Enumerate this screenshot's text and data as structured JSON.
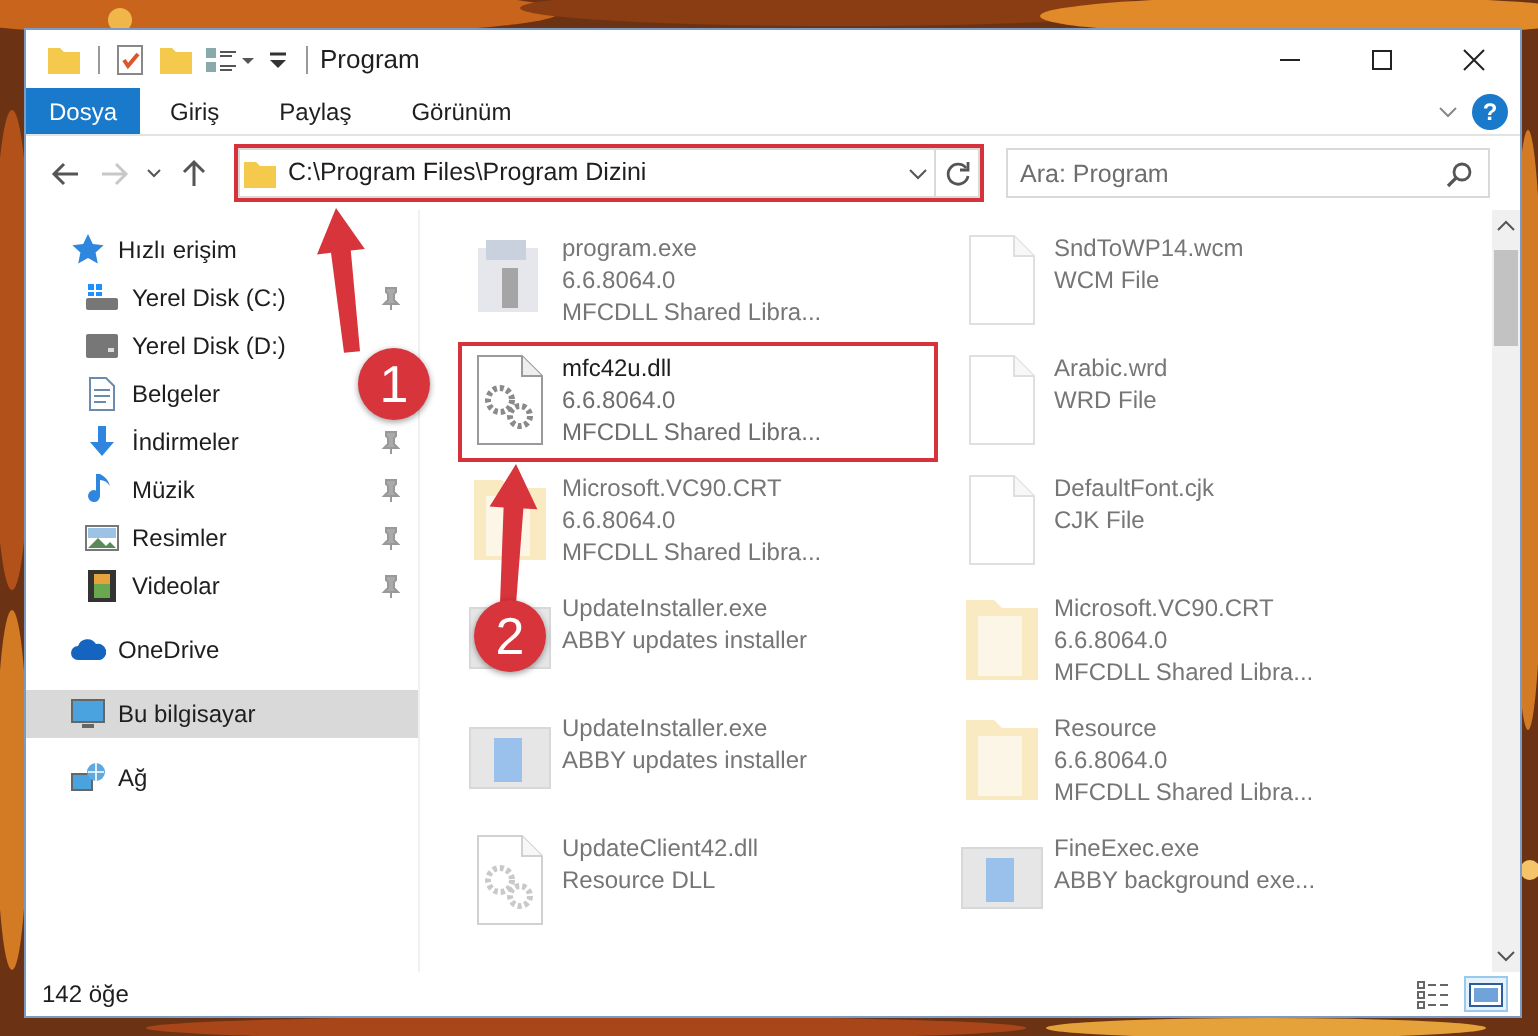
{
  "window": {
    "title": "Program"
  },
  "ribbon_tabs": [
    {
      "label": "Dosya",
      "kind": "file"
    },
    {
      "label": "Giriş",
      "kind": "tab"
    },
    {
      "label": "Paylaş",
      "kind": "tab"
    },
    {
      "label": "Görünüm",
      "kind": "tab"
    }
  ],
  "help": "?",
  "navigation": {
    "back_disabled": false,
    "forward_disabled": true
  },
  "address": {
    "path": "C:\\Program Files\\Program Dizini",
    "annotated": true
  },
  "search": {
    "placeholder": "Ara: Program"
  },
  "sidebar": {
    "items": [
      {
        "label": "Hızlı erişim",
        "kind": "star",
        "selected": false,
        "children": [
          {
            "label": "Yerel Disk (C:)",
            "kind": "system-drive",
            "pinned": true,
            "selected": false
          },
          {
            "label": "Yerel Disk (D:)",
            "kind": "drive",
            "pinned": false,
            "selected": false
          },
          {
            "label": "Belgeler",
            "kind": "documents",
            "pinned": false,
            "selected": false
          },
          {
            "label": "İndirmeler",
            "kind": "downloads",
            "pinned": true,
            "selected": false
          },
          {
            "label": "Müzik",
            "kind": "music",
            "pinned": true,
            "selected": false
          },
          {
            "label": "Resimler",
            "kind": "pictures",
            "pinned": true,
            "selected": false
          },
          {
            "label": "Videolar",
            "kind": "videos",
            "pinned": true,
            "selected": false
          }
        ]
      },
      {
        "label": "OneDrive",
        "kind": "cloud",
        "selected": false
      },
      {
        "label": "Bu bilgisayar",
        "kind": "computer",
        "selected": true
      },
      {
        "label": "Ağ",
        "kind": "network",
        "selected": false
      }
    ]
  },
  "files": [
    {
      "name": "program.exe",
      "details": [
        "6.6.8064.0",
        "MFCDLL Shared Libra..."
      ],
      "kind": "installer",
      "blurred": true,
      "annotated": false
    },
    {
      "name": "SndToWP14.wcm",
      "details": [
        "WCM File"
      ],
      "kind": "document",
      "blurred": true,
      "annotated": false
    },
    {
      "name": "mfc42u.dll",
      "details": [
        "6.6.8064.0",
        "MFCDLL Shared Libra..."
      ],
      "kind": "dll",
      "blurred": false,
      "annotated": true
    },
    {
      "name": "Arabic.wrd",
      "details": [
        "WRD File"
      ],
      "kind": "document",
      "blurred": true,
      "annotated": false
    },
    {
      "name": "Microsoft.VC90.CRT",
      "details": [
        "6.6.8064.0",
        "MFCDLL Shared Libra..."
      ],
      "kind": "folder",
      "blurred": true,
      "annotated": false
    },
    {
      "name": "DefaultFont.cjk",
      "details": [
        "CJK File"
      ],
      "kind": "document",
      "blurred": true,
      "annotated": false
    },
    {
      "name": "UpdateInstaller.exe",
      "details": [
        "ABBY updates installer"
      ],
      "kind": "exe",
      "blurred": true,
      "annotated": false
    },
    {
      "name": "Microsoft.VC90.CRT",
      "details": [
        "6.6.8064.0",
        "MFCDLL Shared Libra..."
      ],
      "kind": "folder",
      "blurred": true,
      "annotated": false
    },
    {
      "name": "UpdateInstaller.exe",
      "details": [
        "ABBY updates installer"
      ],
      "kind": "exe",
      "blurred": true,
      "annotated": false
    },
    {
      "name": "Resource",
      "details": [
        "6.6.8064.0",
        "MFCDLL Shared Libra..."
      ],
      "kind": "folder",
      "blurred": true,
      "annotated": false
    },
    {
      "name": "UpdateClient42.dll",
      "details": [
        "Resource DLL"
      ],
      "kind": "dll",
      "blurred": true,
      "annotated": false
    },
    {
      "name": "FineExec.exe",
      "details": [
        "ABBY background exe..."
      ],
      "kind": "exe",
      "blurred": true,
      "annotated": false
    }
  ],
  "status_bar": {
    "count": "142 öğe"
  },
  "view_buttons": [
    {
      "kind": "details",
      "selected": false
    },
    {
      "kind": "large-icons",
      "selected": true
    }
  ],
  "annotations": [
    {
      "label": "1"
    },
    {
      "label": "2"
    }
  ]
}
